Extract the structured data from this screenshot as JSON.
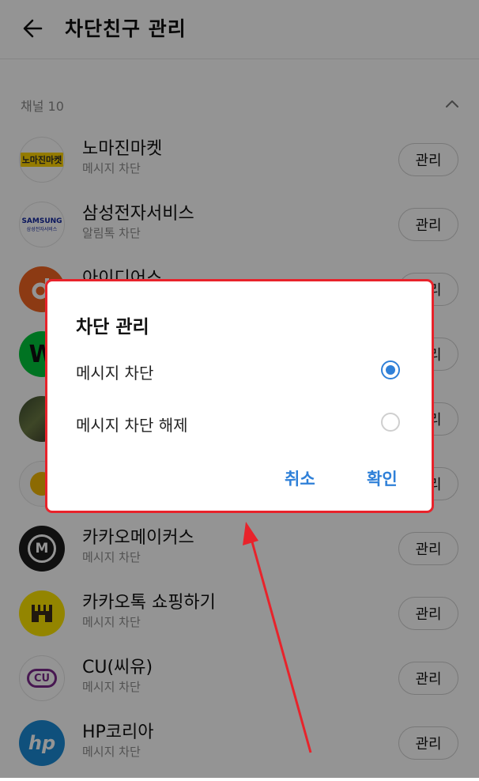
{
  "header": {
    "title": "차단친구 관리"
  },
  "section": {
    "label": "채널 10"
  },
  "manage_label": "관리",
  "channels": [
    {
      "name": "노마진마켓",
      "status": "메시지 차단",
      "logo_text": "노마진마켓"
    },
    {
      "name": "삼성전자서비스",
      "status": "알림톡 차단",
      "logo_text": "SAMSUNG",
      "logo_sub": "삼성전자서비스"
    },
    {
      "name": "아이디어스",
      "status": ""
    },
    {
      "name": "",
      "status": ""
    },
    {
      "name": "",
      "status": ""
    },
    {
      "name": "",
      "status": ""
    },
    {
      "name": "카카오메이커스",
      "status": "메시지 차단",
      "logo_text": "M"
    },
    {
      "name": "카카오톡 쇼핑하기",
      "status": "메시지 차단"
    },
    {
      "name": "CU(씨유)",
      "status": "메시지 차단",
      "logo_text": "CU"
    },
    {
      "name": "HP코리아",
      "status": "메시지 차단",
      "logo_text": "hp"
    }
  ],
  "dialog": {
    "title": "차단 관리",
    "options": [
      {
        "label": "메시지 차단",
        "selected": true
      },
      {
        "label": "메시지 차단 해제",
        "selected": false
      }
    ],
    "cancel": "취소",
    "confirm": "확인"
  },
  "colors": {
    "accent": "#2f80d8",
    "highlight": "#e8232b"
  }
}
